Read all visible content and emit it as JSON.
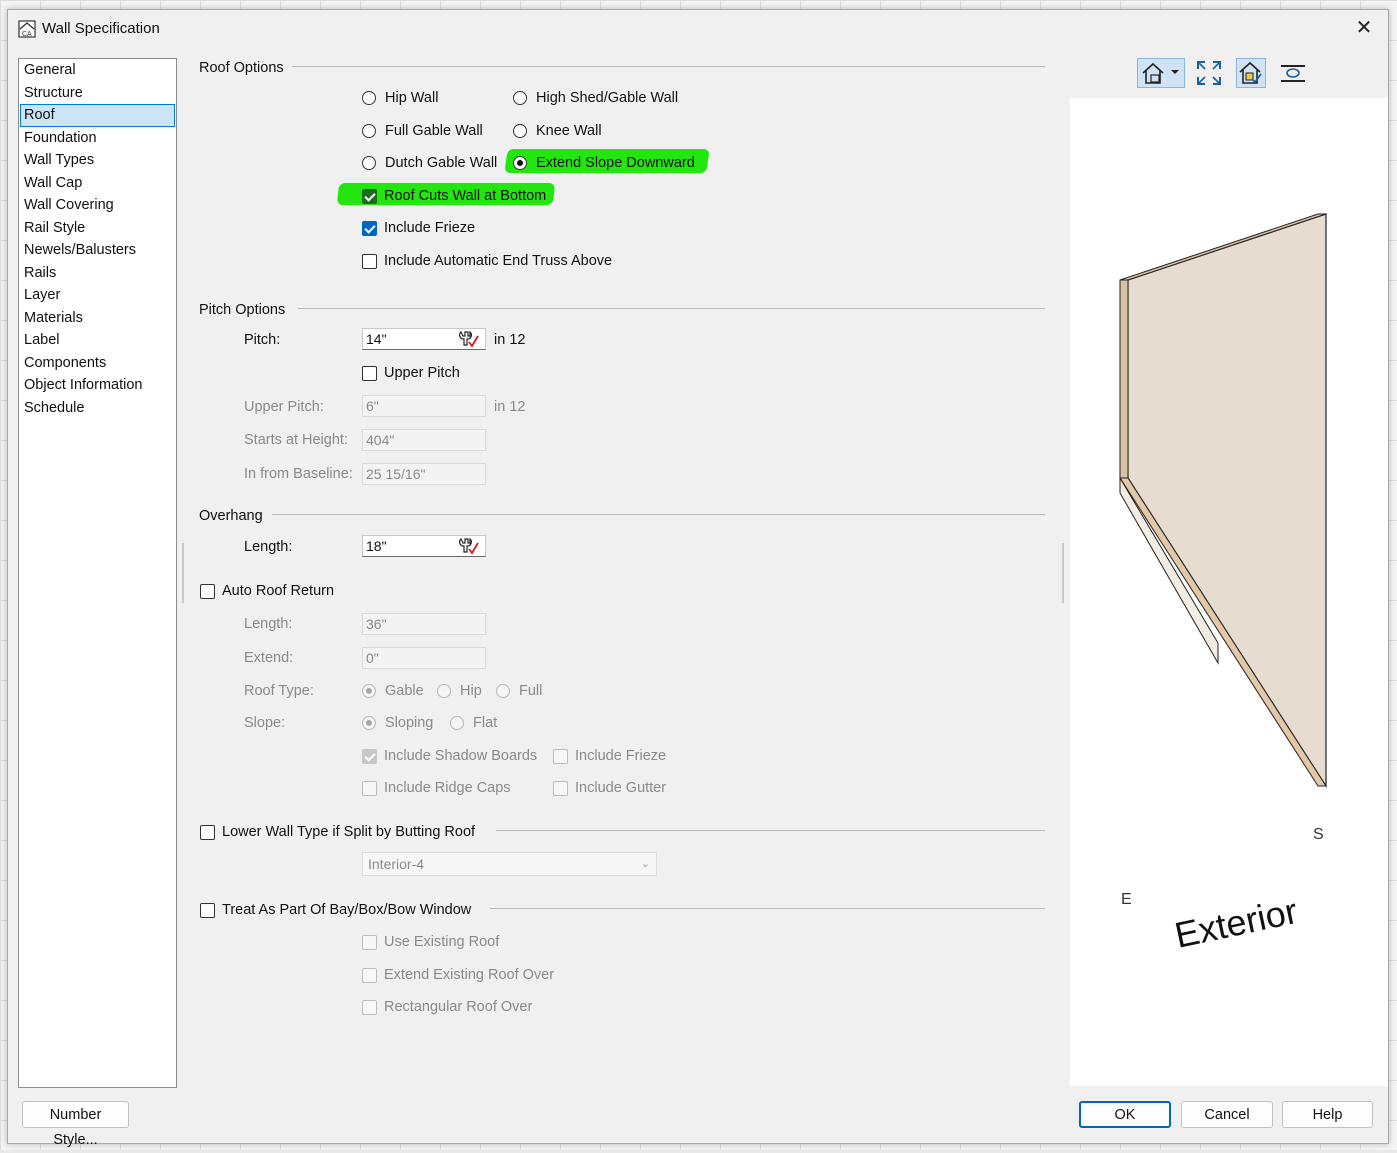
{
  "window": {
    "title": "Wall Specification",
    "close_glyph": "✕"
  },
  "nav": {
    "items": [
      "General",
      "Structure",
      "Roof",
      "Foundation",
      "Wall Types",
      "Wall Cap",
      "Wall Covering",
      "Rail Style",
      "Newels/Balusters",
      "Rails",
      "Layer",
      "Materials",
      "Label",
      "Components",
      "Object Information",
      "Schedule"
    ],
    "selected": "Roof"
  },
  "roof_options": {
    "title": "Roof Options",
    "hip_wall": "Hip Wall",
    "high_shed_gable_wall": "High Shed/Gable Wall",
    "full_gable_wall": "Full Gable Wall",
    "knee_wall": "Knee Wall",
    "dutch_gable_wall": "Dutch Gable Wall",
    "extend_slope_downward": "Extend Slope Downward",
    "roof_cuts_wall_at_bottom": "Roof Cuts Wall at Bottom",
    "include_frieze": "Include Frieze",
    "include_automatic_end_truss_above": "Include Automatic End Truss Above",
    "highlight_color": "#22e60e"
  },
  "pitch_options": {
    "title": "Pitch Options",
    "pitch_label": "Pitch:",
    "pitch_value": "14\"",
    "in_12": "in 12",
    "upper_pitch_check": "Upper Pitch",
    "upper_pitch_label": "Upper Pitch:",
    "upper_pitch_value": "6\"",
    "upper_in_12": "in 12",
    "starts_at_height_label": "Starts at Height:",
    "starts_at_height_value": "404\"",
    "in_from_baseline_label": "In from Baseline:",
    "in_from_baseline_value": "25 15/16\""
  },
  "overhang": {
    "title": "Overhang",
    "length_label": "Length:",
    "length_value": "18\""
  },
  "auto_roof_return": {
    "title": "Auto Roof Return",
    "length_label": "Length:",
    "length_value": "36\"",
    "extend_label": "Extend:",
    "extend_value": "0\"",
    "roof_type_label": "Roof Type:",
    "gable": "Gable",
    "hip": "Hip",
    "full": "Full",
    "slope_label": "Slope:",
    "sloping": "Sloping",
    "flat": "Flat",
    "include_shadow_boards": "Include Shadow Boards",
    "include_frieze": "Include Frieze",
    "include_ridge_caps": "Include Ridge Caps",
    "include_gutter": "Include Gutter"
  },
  "lower_wall_type": {
    "title": "Lower Wall Type if Split by Butting Roof",
    "selected": "Interior-4"
  },
  "bay_window": {
    "title": "Treat As Part Of Bay/Box/Bow Window",
    "use_existing_roof": "Use Existing Roof",
    "extend_existing_roof_over": "Extend Existing Roof Over",
    "rectangular_roof_over": "Rectangular Roof Over"
  },
  "preview": {
    "label_exterior": "Exterior",
    "label_e": "E",
    "label_s": "S"
  },
  "footer": {
    "number_style": "Number Style...",
    "ok": "OK",
    "cancel": "Cancel",
    "help": "Help"
  }
}
